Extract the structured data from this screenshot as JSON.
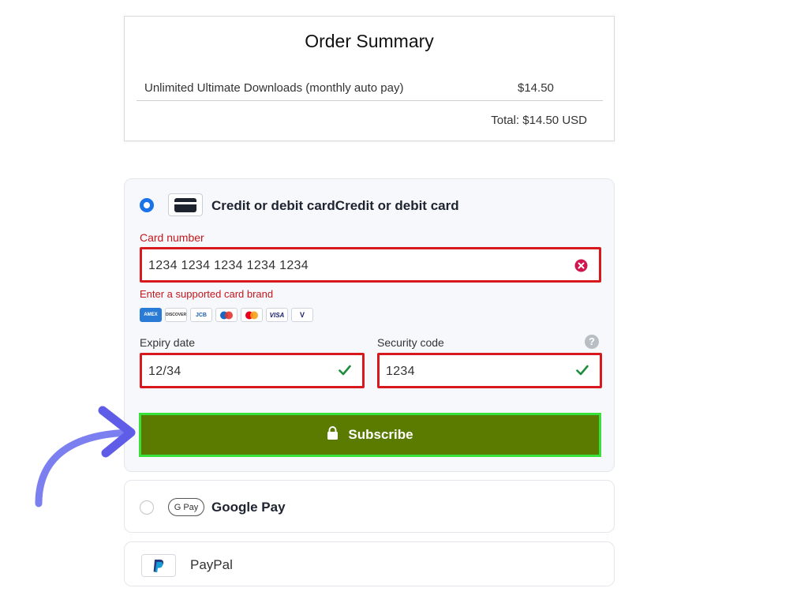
{
  "order_summary": {
    "title": "Order Summary",
    "item_name": "Unlimited Ultimate Downloads (monthly auto pay)",
    "item_price": "$14.50",
    "total": "Total: $14.50 USD"
  },
  "payment": {
    "card": {
      "label": "Credit or debit cardCredit or debit card",
      "card_number_label": "Card number",
      "card_number_value": "1234 1234 1234 1234 1234",
      "card_error": "Enter a supported card brand",
      "brands": [
        "AMEX",
        "DISCOVER",
        "JCB",
        "MAESTRO",
        "MASTERCARD",
        "VISA",
        "V"
      ],
      "expiry_label": "Expiry date",
      "expiry_value": "12/34",
      "security_label": "Security code",
      "security_value": "1234",
      "help_glyph": "?",
      "subscribe_label": "Subscribe"
    },
    "google_pay": {
      "label": "Google Pay",
      "badge": "G Pay"
    },
    "paypal": {
      "label": "PayPal"
    }
  },
  "colors": {
    "error": "#d7191e",
    "subscribe_bg": "#5a7a00",
    "subscribe_border": "#39e03a",
    "radio_selected": "#1a73e8",
    "valid_check": "#1e8e3e",
    "arrow": "#7b7ff0"
  },
  "icons": {
    "card": "credit-card-icon",
    "clear": "error-clear-icon",
    "check": "checkmark-icon",
    "lock": "lock-icon",
    "help": "help-icon",
    "paypal": "paypal-logo-icon",
    "arrow": "curved-arrow-icon"
  }
}
